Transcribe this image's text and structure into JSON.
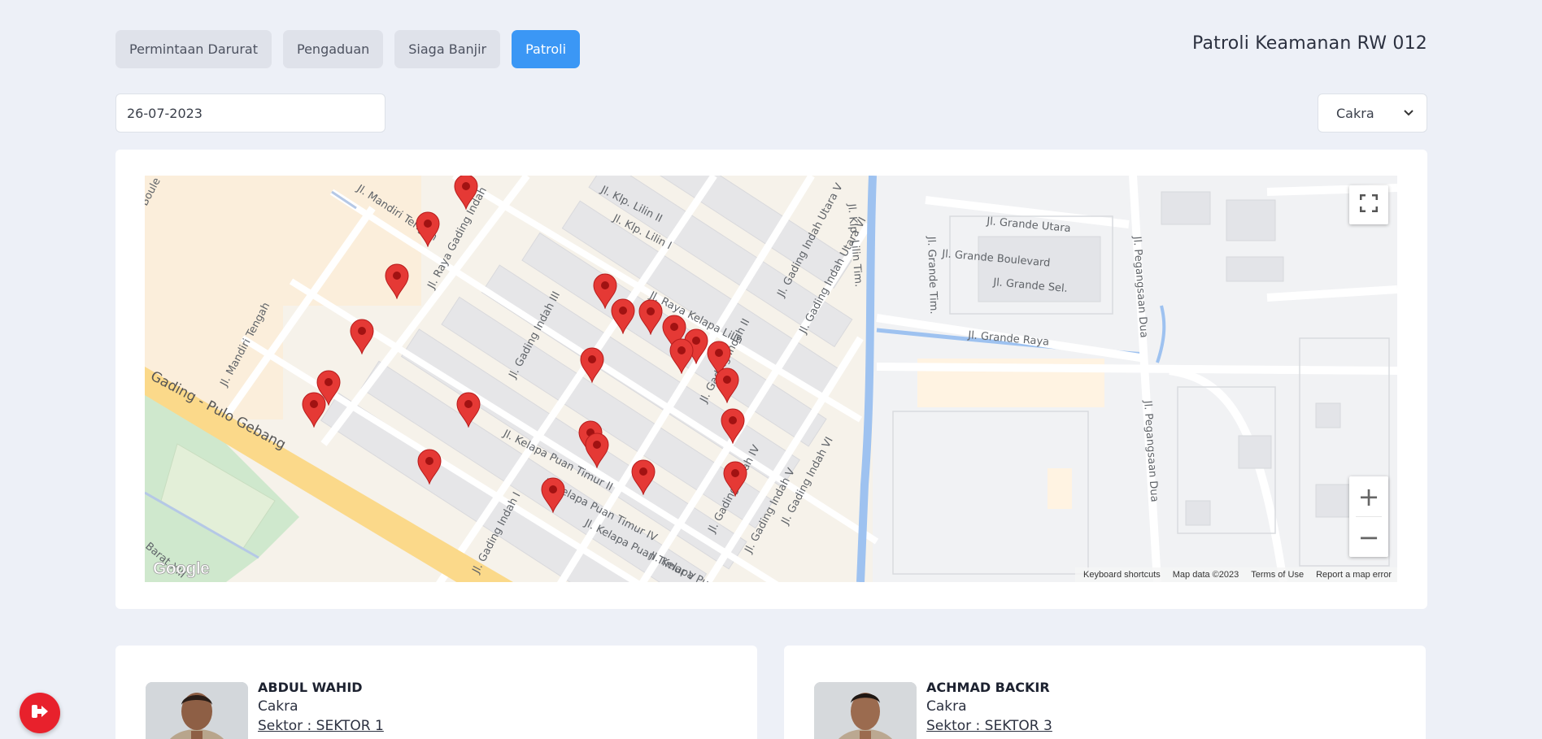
{
  "tabs": [
    {
      "label": "Permintaan Darurat",
      "active": false
    },
    {
      "label": "Pengaduan",
      "active": false
    },
    {
      "label": "Siaga Banjir",
      "active": false
    },
    {
      "label": "Patroli",
      "active": true
    }
  ],
  "page_title": "Patroli Keamanan RW 012",
  "filters": {
    "date_value": "26-07-2023",
    "officer_selected": "Cakra"
  },
  "map": {
    "street_labels": [
      "Jl. Mandiri Tengah",
      "Jl. Mandiri Tengah",
      "Jl. Raya Gading Indah",
      "Jl. Raya Kelapa Lilin",
      "Jl. Gading Indah I",
      "Jl. Gading Indah II",
      "Jl. Gading Indah III",
      "Jl. Gading Indah IV",
      "Jl. Gading Indah V",
      "Jl. Gading Indah VI",
      "Jl. Gading Indah Utara V",
      "Jl. Gading Indah Utara VI",
      "Jl. Kelapa Puan Timur II",
      "Jl. Kelapa Puan Timur IV",
      "Jl. Kelapa Puan Timur V",
      "Jl. Kelapa Puan",
      "Jl. Klp. Lilin II",
      "Jl. Klp. Lilin I",
      "Jl. Klp. Lilin Tim.",
      "Jl. Grande Utara",
      "Jl. Grande Boulevard",
      "Jl. Grande Sel.",
      "Jl. Grande Raya",
      "Jl. Grande Tim.",
      "Jl. Pegangsaan Dua",
      "Jl. Pegangsaan Dua",
      "Gading - Pulo Gebang",
      "Barat XIII",
      "Boule"
    ],
    "google_logo": "Google",
    "footer": {
      "keyboard_shortcuts": "Keyboard shortcuts",
      "map_data": "Map data ©2023",
      "terms": "Terms of Use",
      "report": "Report a map error"
    },
    "marker_count": 25,
    "marker_color": "#e53935"
  },
  "officers": [
    {
      "name": "ABDUL WAHID",
      "team": "Cakra",
      "sector": "Sektor : SEKTOR 1"
    },
    {
      "name": "ACHMAD BACKIR",
      "team": "Cakra",
      "sector": "Sektor : SEKTOR 3"
    }
  ],
  "icons": {
    "fullscreen": "fullscreen-icon",
    "zoom_in": "+",
    "zoom_out": "−",
    "logout": "logout-icon"
  },
  "colors": {
    "accent": "#3b97f5",
    "logout": "#e8212c",
    "background": "#edf0f7"
  }
}
